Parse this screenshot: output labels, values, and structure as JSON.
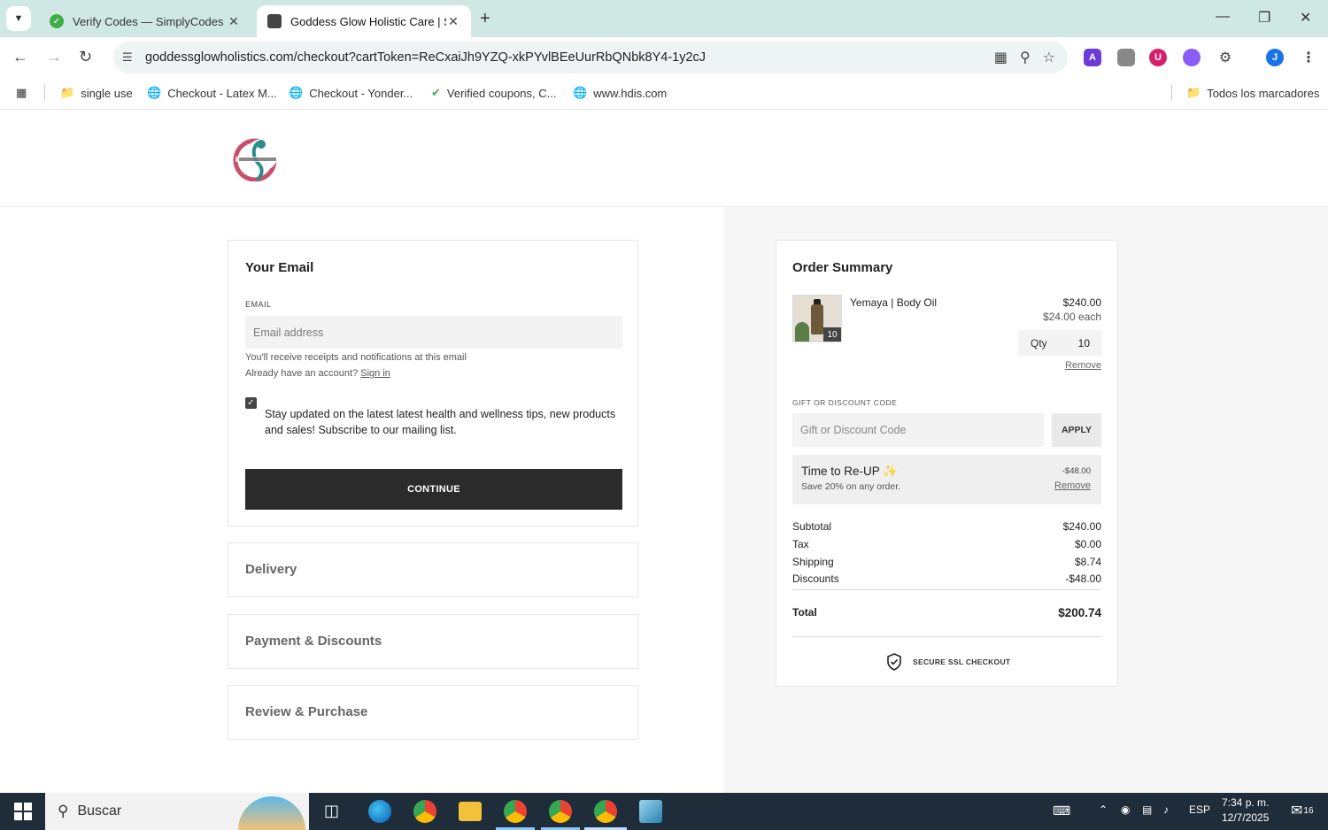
{
  "browser": {
    "tabs": [
      {
        "title": "Verify Codes — SimplyCodes",
        "active": false
      },
      {
        "title": "Goddess Glow Holistic Care | Se",
        "active": true
      }
    ],
    "url": "goddessglowholistics.com/checkout?cartToken=ReCxaiJh9YZQ-xkPYvlBEeUurRbQNbk8Y4-1y2cJ",
    "bookmarks": [
      "single use",
      "Checkout - Latex M...",
      "Checkout - Yonder...",
      "Verified coupons, C...",
      "www.hdis.com"
    ],
    "all_bookmarks": "Todos los marcadores",
    "profile_initial": "J"
  },
  "email_section": {
    "title": "Your Email",
    "label": "EMAIL",
    "placeholder": "Email address",
    "helper": "You'll receive receipts and notifications at this email",
    "account_prompt": "Already have an account?",
    "signin": "Sign in",
    "subscribe_checked": true,
    "subscribe_text": "Stay updated on the latest latest health and wellness tips, new products and sales! Subscribe to our mailing list.",
    "continue": "CONTINUE"
  },
  "steps": [
    "Delivery",
    "Payment & Discounts",
    "Review & Purchase"
  ],
  "summary": {
    "title": "Order Summary",
    "item": {
      "name": "Yemaya | Body Oil",
      "price": "$240.00",
      "each": "$24.00 each",
      "qty_label": "Qty",
      "qty": "10",
      "badge": "10",
      "remove": "Remove"
    },
    "gift_label": "GIFT OR DISCOUNT CODE",
    "gift_placeholder": "Gift or Discount Code",
    "apply": "APPLY",
    "promo": {
      "title": "Time to Re-UP",
      "emoji": "✨",
      "subtitle": "Save 20% on any order.",
      "amount": "-$48.00",
      "remove": "Remove"
    },
    "rows": [
      {
        "label": "Subtotal",
        "value": "$240.00"
      },
      {
        "label": "Tax",
        "value": "$0.00"
      },
      {
        "label": "Shipping",
        "value": "$8.74"
      },
      {
        "label": "Discounts",
        "value": "-$48.00"
      }
    ],
    "total_label": "Total",
    "total_value": "$200.74",
    "ssl": "SECURE SSL CHECKOUT"
  },
  "taskbar": {
    "search": "Buscar",
    "lang": "ESP",
    "time": "7:34 p. m.",
    "date": "12/7/2025",
    "notifications": "16"
  },
  "colors": {
    "tabstrip": "#cfe8e3",
    "button_dark": "#2b2b2b",
    "taskbar": "#1f2d3a"
  }
}
